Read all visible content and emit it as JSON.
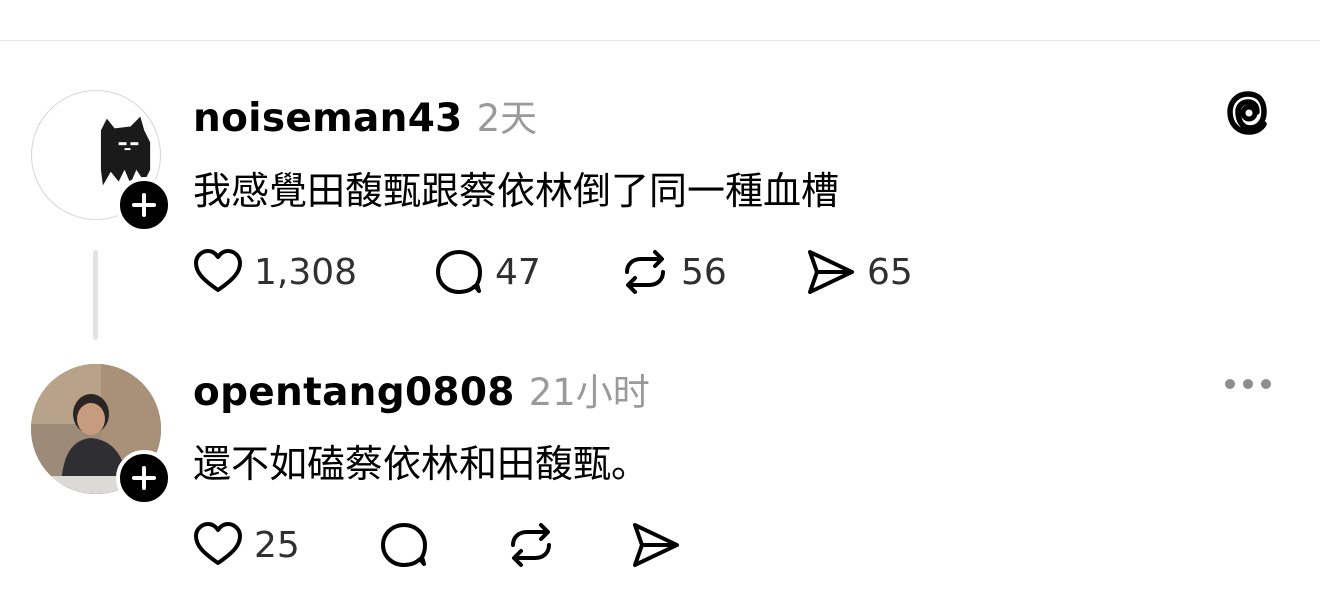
{
  "posts": [
    {
      "username": "noiseman43",
      "time": "2天",
      "text": "我感覺田馥甄跟蔡依林倒了同一種血槽",
      "likes": "1,308",
      "comments": "47",
      "reposts": "56",
      "shares": "65"
    },
    {
      "username": "opentang0808",
      "time": "21小时",
      "text": "還不如磕蔡依林和田馥甄。",
      "likes": "25"
    }
  ],
  "icons": {
    "top_right": "threads-logo-icon",
    "reply_menu": "more-horizontal-icon",
    "follow": "plus-icon",
    "like": "heart-icon",
    "comment": "comment-bubble-icon",
    "repost": "repost-icon",
    "share": "send-icon"
  }
}
